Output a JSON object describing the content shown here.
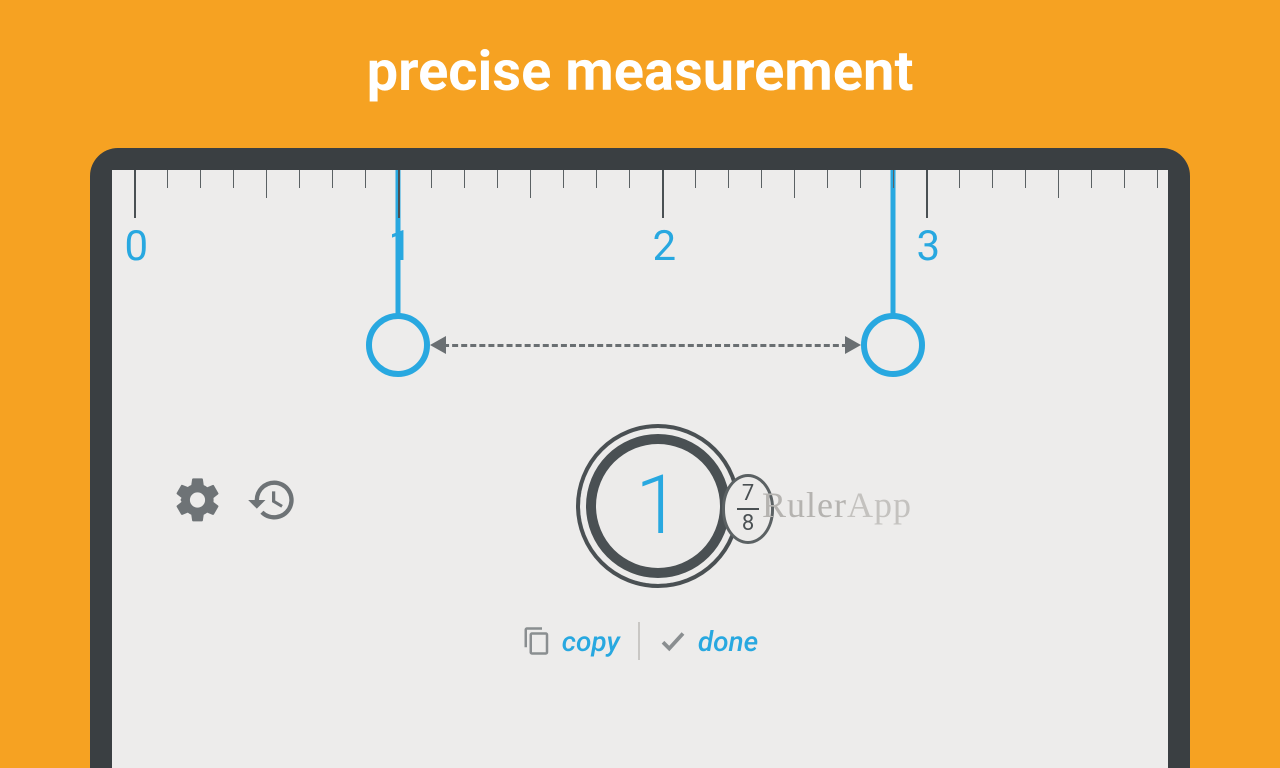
{
  "hero": {
    "title": "precise measurement"
  },
  "ruler": {
    "labels": [
      "0",
      "1",
      "2",
      "3"
    ],
    "marker_left_pos": 1.0,
    "marker_right_pos": 2.875
  },
  "result": {
    "whole": "1",
    "frac_num": "7",
    "frac_den": "8"
  },
  "brand": {
    "part1": "Ruler",
    "part2": "App"
  },
  "actions": {
    "copy_label": "copy",
    "done_label": "done"
  },
  "icons": {
    "settings": "gear-icon",
    "history": "history-icon",
    "copy": "copy-icon",
    "done": "check-icon"
  },
  "colors": {
    "accent": "#28A8E0",
    "bg": "#F6A222",
    "frame": "#3A3F42",
    "surface": "#EDECEB",
    "muted": "#6E7376"
  }
}
